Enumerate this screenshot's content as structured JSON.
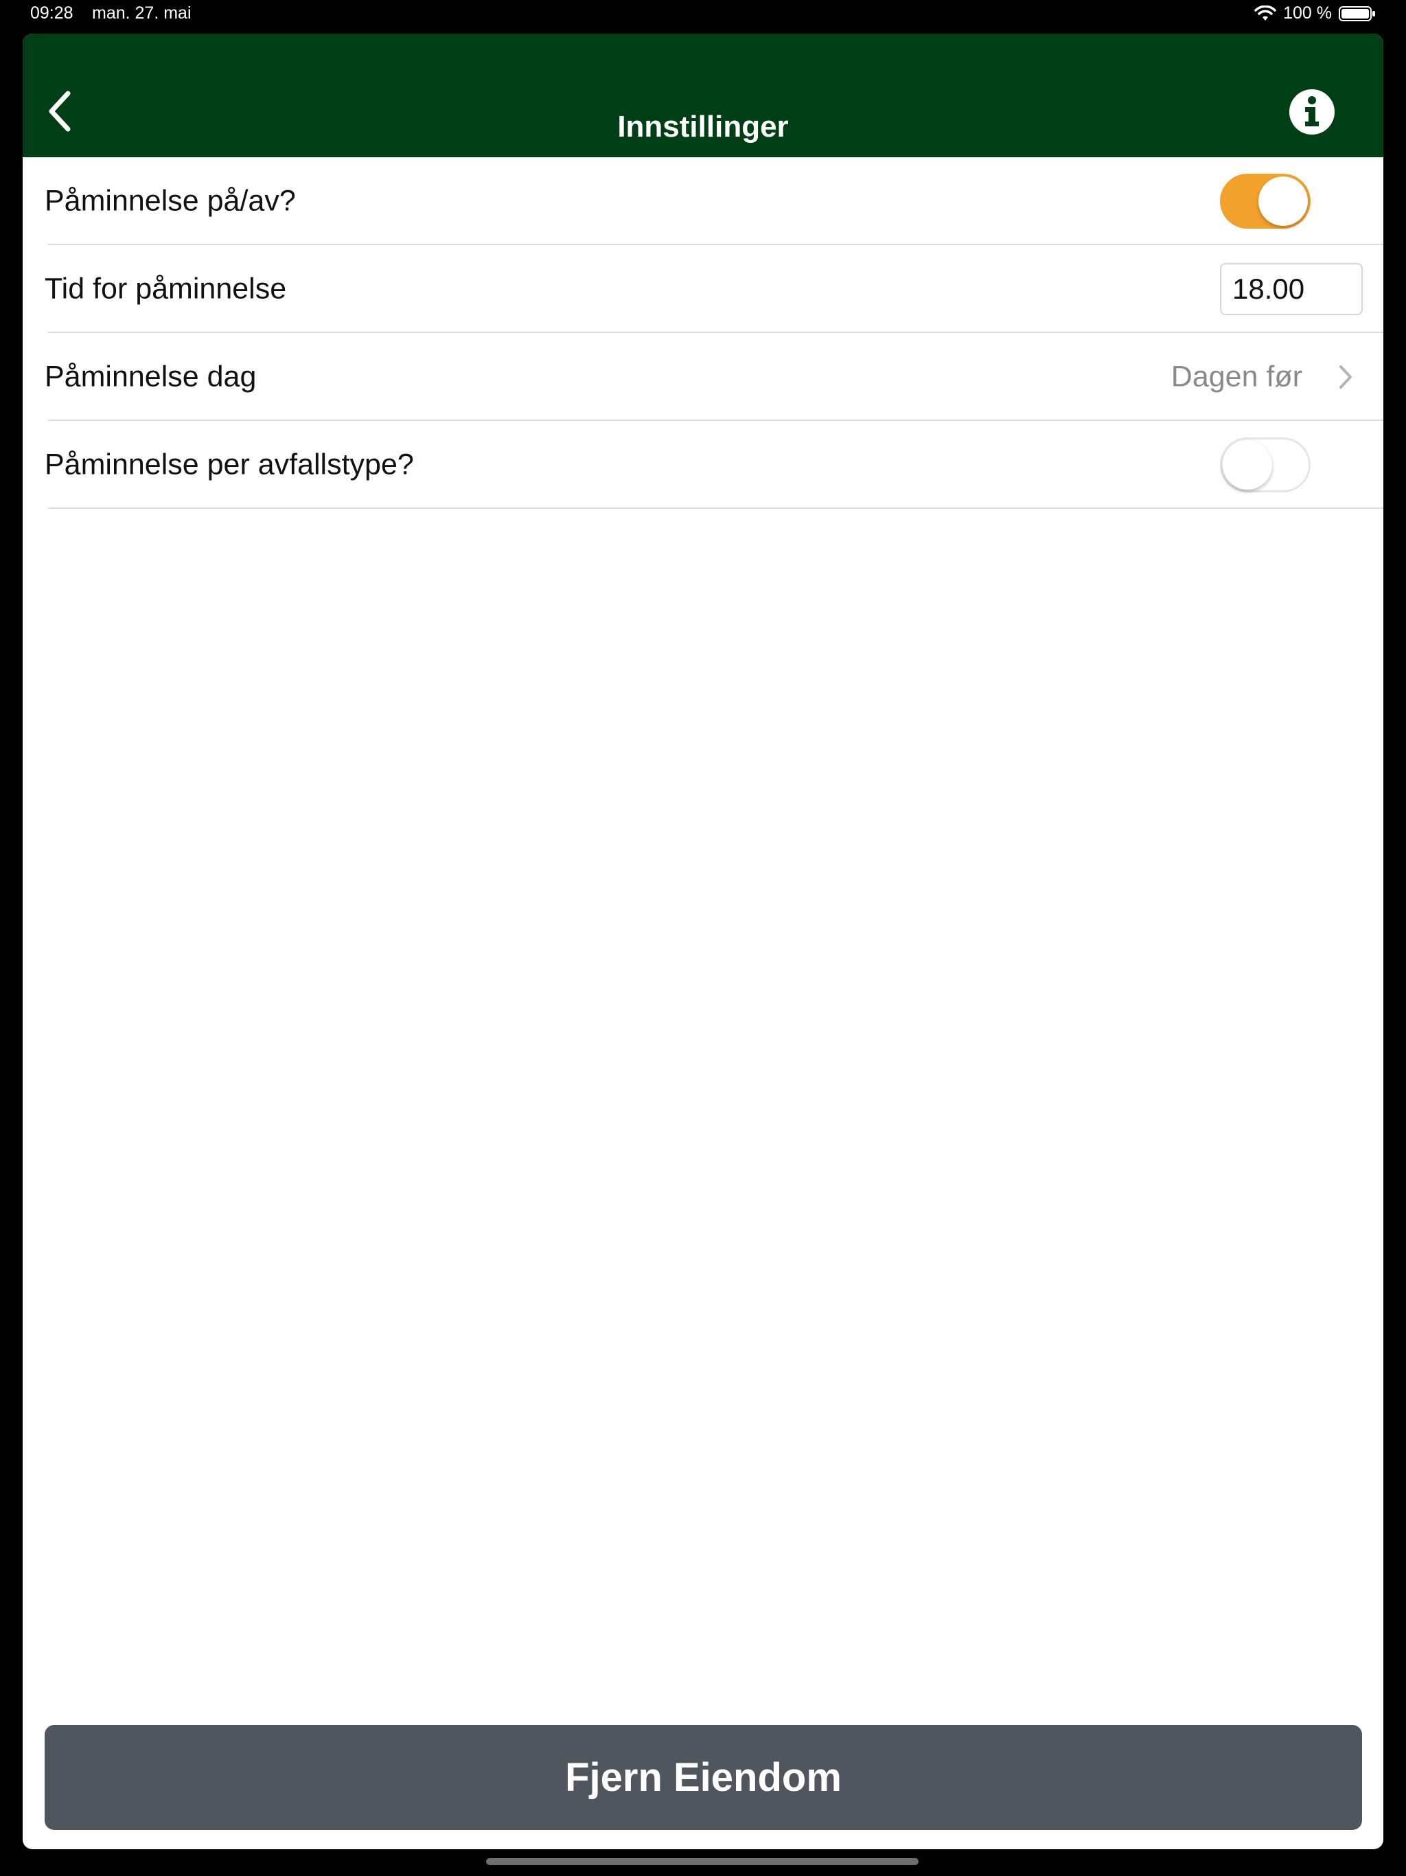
{
  "status_bar": {
    "time": "09:28",
    "date": "man. 27. mai",
    "battery": "100 %"
  },
  "nav": {
    "title": "Innstillinger",
    "back_icon": "chevron-left-icon",
    "info_icon": "info-icon"
  },
  "settings": {
    "reminder_toggle": {
      "label": "Påminnelse på/av?",
      "on": true
    },
    "reminder_time": {
      "label": "Tid for påminnelse",
      "value": "18.00"
    },
    "reminder_day": {
      "label": "Påminnelse dag",
      "value": "Dagen før"
    },
    "per_waste_type": {
      "label": "Påminnelse per avfallstype?",
      "on": false
    }
  },
  "actions": {
    "remove_label": "Fjern Eiendom"
  },
  "colors": {
    "navbar": "#003e16",
    "accent_toggle": "#f2a22c",
    "remove_button": "#4f565e"
  }
}
